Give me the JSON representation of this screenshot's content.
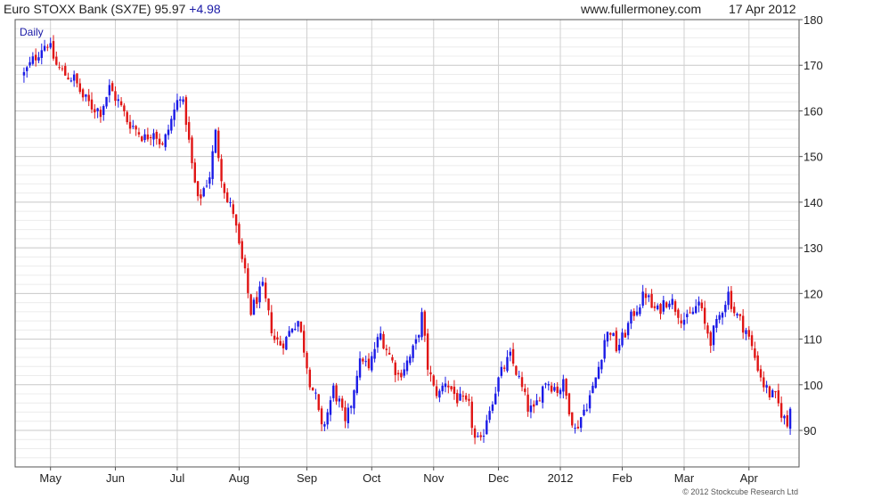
{
  "header": {
    "title": "Euro STOXX Bank (SX7E) 95.97",
    "change": "+4.98",
    "site": "www.fullermoney.com",
    "date": "17 Apr 2012"
  },
  "footer": {
    "copyright": "© 2012 Stockcube Research Ltd"
  },
  "colors": {
    "up": "#1a1ae6",
    "down": "#e01515",
    "grid": "#d4d4d4",
    "axis": "#555555"
  },
  "chart_data": {
    "type": "candlestick",
    "period_label": "Daily",
    "ylim": [
      82,
      180
    ],
    "y_ticks": [
      90,
      100,
      110,
      120,
      130,
      140,
      150,
      160,
      170,
      180
    ],
    "x_ticks": [
      {
        "label": "May",
        "day": 0
      },
      {
        "label": "Jun",
        "day": 22
      },
      {
        "label": "Jul",
        "day": 43
      },
      {
        "label": "Aug",
        "day": 64
      },
      {
        "label": "Sep",
        "day": 87
      },
      {
        "label": "Oct",
        "day": 109
      },
      {
        "label": "Nov",
        "day": 130
      },
      {
        "label": "Dec",
        "day": 152
      },
      {
        "label": "2012",
        "day": 173
      },
      {
        "label": "Feb",
        "day": 194
      },
      {
        "label": "Mar",
        "day": 215
      },
      {
        "label": "Apr",
        "day": 237
      }
    ],
    "close_path": [
      [
        -9,
        168
      ],
      [
        -6,
        171
      ],
      [
        -3,
        174
      ],
      [
        -1,
        175
      ],
      [
        2,
        170
      ],
      [
        5,
        168
      ],
      [
        8,
        167
      ],
      [
        11,
        163
      ],
      [
        14,
        161
      ],
      [
        17,
        160
      ],
      [
        20,
        165
      ],
      [
        23,
        162
      ],
      [
        26,
        158
      ],
      [
        29,
        156
      ],
      [
        32,
        154
      ],
      [
        35,
        156
      ],
      [
        38,
        152
      ],
      [
        41,
        158
      ],
      [
        44,
        164
      ],
      [
        46,
        158
      ],
      [
        48,
        148
      ],
      [
        50,
        140
      ],
      [
        52,
        143
      ],
      [
        54,
        146
      ],
      [
        56,
        155
      ],
      [
        58,
        146
      ],
      [
        60,
        140
      ],
      [
        62,
        138
      ],
      [
        64,
        130
      ],
      [
        66,
        124
      ],
      [
        68,
        116
      ],
      [
        70,
        119
      ],
      [
        72,
        121
      ],
      [
        74,
        115
      ],
      [
        76,
        110
      ],
      [
        78,
        109
      ],
      [
        80,
        110
      ],
      [
        82,
        113
      ],
      [
        84,
        114
      ],
      [
        86,
        108
      ],
      [
        88,
        101
      ],
      [
        90,
        97
      ],
      [
        92,
        90
      ],
      [
        94,
        94
      ],
      [
        96,
        99
      ],
      [
        98,
        96
      ],
      [
        100,
        91
      ],
      [
        102,
        96
      ],
      [
        104,
        103
      ],
      [
        106,
        106
      ],
      [
        108,
        103
      ],
      [
        110,
        108
      ],
      [
        112,
        111
      ],
      [
        114,
        108
      ],
      [
        116,
        105
      ],
      [
        118,
        102
      ],
      [
        120,
        104
      ],
      [
        122,
        106
      ],
      [
        124,
        109
      ],
      [
        126,
        115
      ],
      [
        128,
        104
      ],
      [
        130,
        99
      ],
      [
        132,
        98
      ],
      [
        134,
        101
      ],
      [
        136,
        99
      ],
      [
        138,
        97
      ],
      [
        140,
        96
      ],
      [
        142,
        95
      ],
      [
        144,
        88
      ],
      [
        146,
        87
      ],
      [
        148,
        93
      ],
      [
        150,
        97
      ],
      [
        152,
        101
      ],
      [
        154,
        104
      ],
      [
        156,
        106
      ],
      [
        158,
        103
      ],
      [
        160,
        99
      ],
      [
        162,
        95
      ],
      [
        164,
        94
      ],
      [
        166,
        98
      ],
      [
        168,
        101
      ],
      [
        170,
        100
      ],
      [
        172,
        99
      ],
      [
        174,
        100
      ],
      [
        176,
        95
      ],
      [
        178,
        90
      ],
      [
        180,
        93
      ],
      [
        182,
        96
      ],
      [
        184,
        99
      ],
      [
        186,
        104
      ],
      [
        188,
        110
      ],
      [
        190,
        112
      ],
      [
        192,
        108
      ],
      [
        194,
        110
      ],
      [
        196,
        113
      ],
      [
        198,
        116
      ],
      [
        200,
        118
      ],
      [
        202,
        120
      ],
      [
        204,
        117
      ],
      [
        206,
        116
      ],
      [
        208,
        118
      ],
      [
        210,
        119
      ],
      [
        212,
        117
      ],
      [
        214,
        115
      ],
      [
        216,
        114
      ],
      [
        218,
        116
      ],
      [
        220,
        118
      ],
      [
        222,
        113
      ],
      [
        224,
        110
      ],
      [
        226,
        113
      ],
      [
        228,
        117
      ],
      [
        230,
        120
      ],
      [
        232,
        116
      ],
      [
        234,
        114
      ],
      [
        236,
        112
      ],
      [
        238,
        108
      ],
      [
        240,
        104
      ],
      [
        242,
        100
      ],
      [
        244,
        98
      ],
      [
        246,
        97
      ],
      [
        248,
        94
      ],
      [
        250,
        91
      ],
      [
        251,
        96
      ]
    ],
    "day_range": [
      -12,
      254
    ]
  }
}
